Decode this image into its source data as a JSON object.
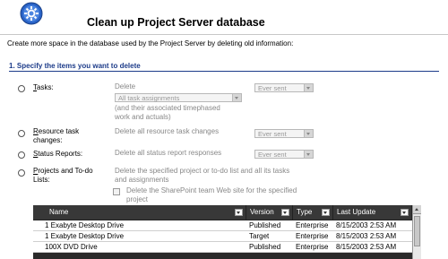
{
  "header": {
    "title": "Clean up Project Server database",
    "logo_icon": "gear-icon"
  },
  "intro": "Create more space in the database used by the Project Server by deleting old information:",
  "section1": {
    "title": "1. Specify the items you want to delete"
  },
  "options": {
    "tasks": {
      "label_u": "T",
      "label_rest": "asks:",
      "delete_label": "Delete",
      "select_value": "All task assignments",
      "note_line1": "(and their associated timephased",
      "note_line2": "work and actuals)",
      "when_value": "Ever sent"
    },
    "resource": {
      "label_u": "R",
      "label_line1_rest": "esource task",
      "label_line2": "changes:",
      "desc": "Delete all resource task changes",
      "when_value": "Ever sent"
    },
    "status": {
      "label_u": "S",
      "label_rest": "tatus Reports:",
      "desc": "Delete all status report responses",
      "when_value": "Ever sent"
    },
    "projects": {
      "label_u": "P",
      "label_line1_rest": "rojects and To-do",
      "label_line2": "Lists:",
      "desc_line1": "Delete the specified project or to-do list and all its tasks",
      "desc_line2": "and assignments",
      "checkbox_line1": "Delete the SharePoint team Web site for the specified",
      "checkbox_line2": "project"
    }
  },
  "grid": {
    "columns": [
      "Name",
      "Version",
      "Type",
      "Last Update"
    ],
    "rows": [
      [
        "1 Exabyte Desktop Drive",
        "Published",
        "Enterprise",
        "8/15/2003 2:53 AM"
      ],
      [
        "1 Exabyte Desktop Drive",
        "Target",
        "Enterprise",
        "8/15/2003 2:53 AM"
      ],
      [
        "100X DVD Drive",
        "Published",
        "Enterprise",
        "8/15/2003 2:53 AM"
      ]
    ]
  }
}
